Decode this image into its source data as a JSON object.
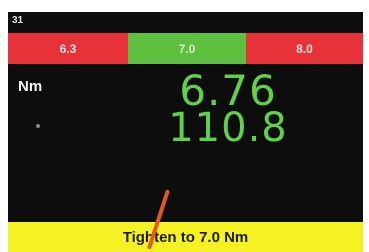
{
  "status": {
    "top_left_label": "31"
  },
  "range_bar": {
    "low_label": "6.3",
    "target_label": "7.0",
    "high_label": "8.0"
  },
  "readings": {
    "unit_label": "Nm",
    "torque_value": "6.76",
    "angle_value": "110.8"
  },
  "banner": {
    "message": "Tighten to 7.0 Nm"
  },
  "colors": {
    "background": "#0d0d0d",
    "out_of_range": "#e8323a",
    "in_range": "#5fbf3f",
    "reading_text": "#5fd24a",
    "banner": "#f5f122"
  }
}
